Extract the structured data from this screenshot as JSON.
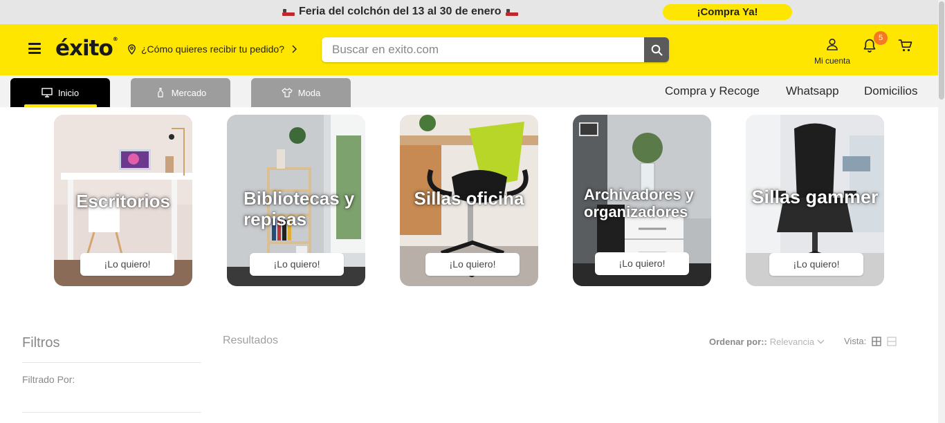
{
  "promo": {
    "text": "Feria del colchón del 13 al 30 de enero",
    "cta": "¡Compra Ya!"
  },
  "header": {
    "logo": "éxito",
    "delivery_prompt": "¿Cómo quieres recibir tu pedido?",
    "search_placeholder": "Buscar en exito.com",
    "account_label": "Mi cuenta",
    "notifications_count": "5"
  },
  "tabs": [
    {
      "label": "Inicio",
      "icon": "monitor-icon",
      "active": true
    },
    {
      "label": "Mercado",
      "icon": "bottle-icon",
      "active": false
    },
    {
      "label": "Moda",
      "icon": "shirt-icon",
      "active": false
    }
  ],
  "top_links": [
    "Compra y Recoge",
    "Whatsapp",
    "Domicilios"
  ],
  "cards": [
    {
      "title": "Escritorios",
      "button": "¡Lo quiero!"
    },
    {
      "title": "Bibliotecas y repisas",
      "button": "¡Lo quiero!"
    },
    {
      "title": "Sillas oficina",
      "button": "¡Lo quiero!"
    },
    {
      "title": "Archivadores y organizadores",
      "button": "¡Lo quiero!"
    },
    {
      "title": "Sillas gammer",
      "button": "¡Lo quiero!"
    }
  ],
  "filters": {
    "title": "Filtros",
    "filtered_by": "Filtrado Por:"
  },
  "results": {
    "title": "Resultados",
    "order_label": "Ordenar por::",
    "order_value": "Relevancia",
    "view_label": "Vista:"
  },
  "colors": {
    "brand_yellow": "#ffe600",
    "badge_orange": "#f47920",
    "logo_red": "#d0021b"
  }
}
